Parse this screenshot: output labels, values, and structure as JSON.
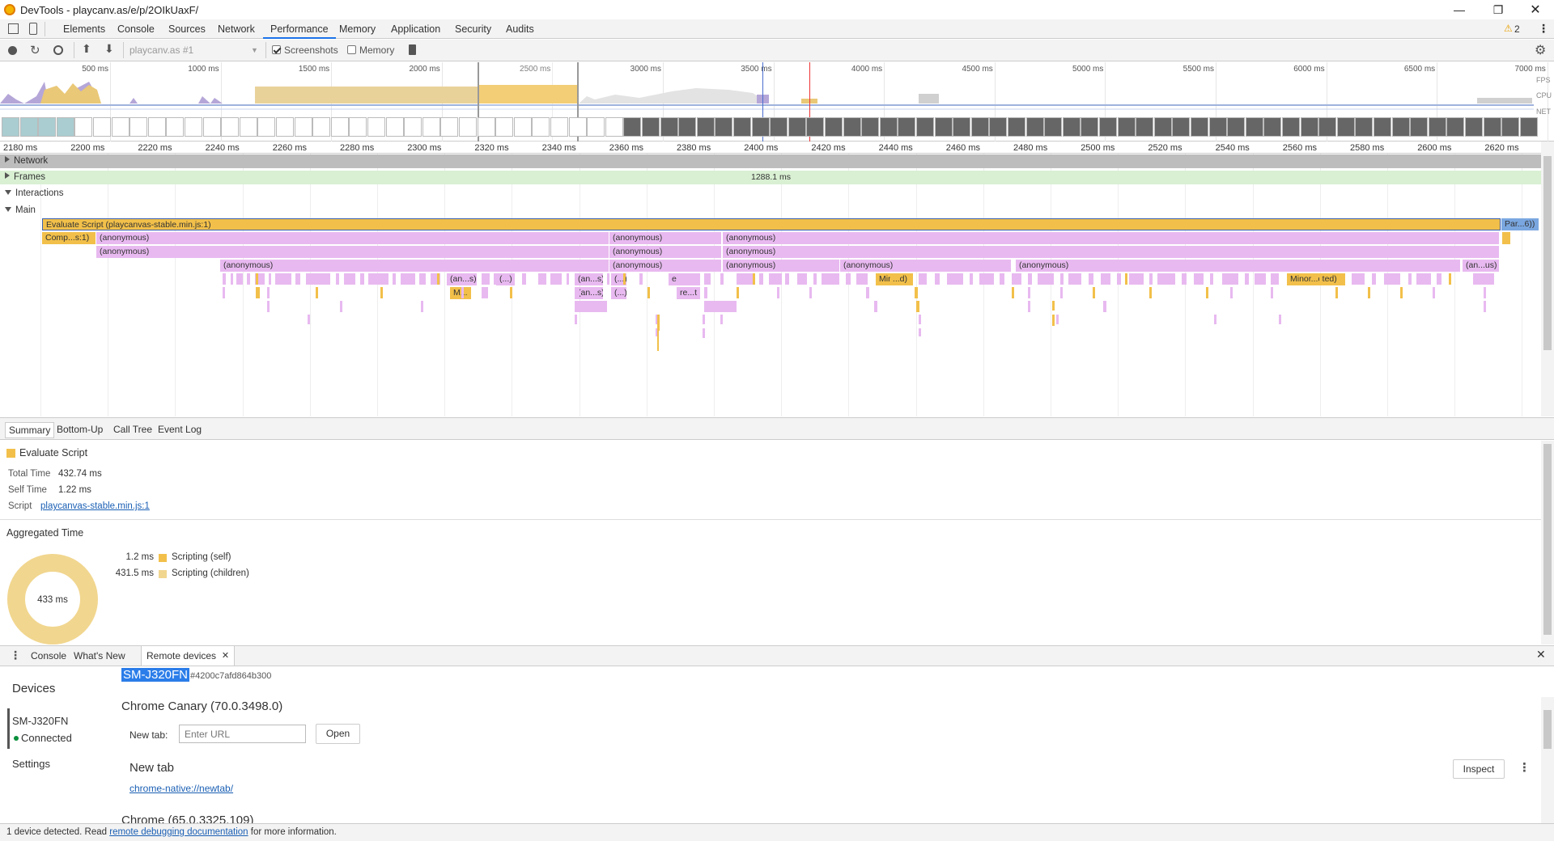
{
  "window": {
    "title": "DevTools - playcanv.as/e/p/2OIkUaxF/",
    "warning_count": "2"
  },
  "main_tabs": [
    "Elements",
    "Console",
    "Sources",
    "Network",
    "Performance",
    "Memory",
    "Application",
    "Security",
    "Audits"
  ],
  "toolbar": {
    "profile_select": "playcanv.as #1",
    "screenshots_label": "Screenshots",
    "screenshots_checked": true,
    "memory_label": "Memory",
    "memory_checked": false
  },
  "overview": {
    "ticks": [
      "500 ms",
      "1000 ms",
      "1500 ms",
      "2000 ms",
      "2500 ms",
      "3000 ms",
      "3500 ms",
      "4000 ms",
      "4500 ms",
      "5000 ms",
      "5500 ms",
      "6000 ms",
      "6500 ms",
      "7000 ms"
    ],
    "lanes": [
      "FPS",
      "CPU",
      "NET"
    ]
  },
  "ruler": [
    "2180 ms",
    "2200 ms",
    "2220 ms",
    "2240 ms",
    "2260 ms",
    "2280 ms",
    "2300 ms",
    "2320 ms",
    "2340 ms",
    "2360 ms",
    "2380 ms",
    "2400 ms",
    "2420 ms",
    "2440 ms",
    "2460 ms",
    "2480 ms",
    "2500 ms",
    "2520 ms",
    "2540 ms",
    "2560 ms",
    "2580 ms",
    "2600 ms",
    "2620 ms"
  ],
  "tracks": {
    "network": "Network",
    "frames": "Frames",
    "frame_time": "1288.1 ms",
    "interactions": "Interactions",
    "main": "Main"
  },
  "flame": {
    "top": "Evaluate Script (playcanvas-stable.min.js:1)",
    "top_right": "Par...6))",
    "comp": "Comp...s:1)",
    "anon": "(anonymous)",
    "an_s": "(an...s)",
    "dots": "(...)",
    "an_us": "(an...us)",
    "min_d": "Min...d)",
    "minor": "Minor...cted)",
    "m": "M...",
    "e": "e",
    "ret": "re...t"
  },
  "detail_tabs": [
    "Summary",
    "Bottom-Up",
    "Call Tree",
    "Event Log"
  ],
  "summary": {
    "title": "Evaluate Script",
    "color": "#f2c04a",
    "total_time_key": "Total Time",
    "total_time": "432.74 ms",
    "self_time_key": "Self Time",
    "self_time": "1.22 ms",
    "script_key": "Script",
    "script": "playcanvas-stable.min.js:1",
    "aggregated_title": "Aggregated Time",
    "donut_label": "433 ms",
    "legend": [
      {
        "value": "1.2 ms",
        "label": "Scripting (self)"
      },
      {
        "value": "431.5 ms",
        "label": "Scripting (children)"
      }
    ]
  },
  "drawer": {
    "tabs": [
      "Console",
      "What's New",
      "Remote devices"
    ]
  },
  "remote": {
    "devices_heading": "Devices",
    "device_name": "SM-J320FN",
    "device_status": "Connected",
    "settings": "Settings",
    "selected_device": "SM-J320FN",
    "device_id": "#4200c7afd864b300",
    "browser": "Chrome Canary (70.0.3498.0)",
    "new_tab_label": "New tab:",
    "url_placeholder": "Enter URL",
    "open_button": "Open",
    "page_title": "New tab",
    "page_url": "chrome-native://newtab/",
    "inspect_button": "Inspect",
    "next_browser": "Chrome (65.0.3325.109)"
  },
  "status": {
    "prefix": "1 device detected. Read ",
    "link": "remote debugging documentation",
    "suffix": " for more information."
  }
}
